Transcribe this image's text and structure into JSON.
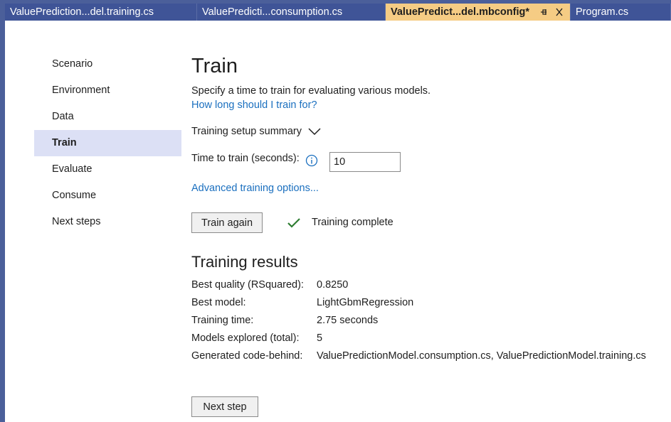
{
  "tabs": [
    {
      "label": "ValuePrediction...del.training.cs",
      "active": false
    },
    {
      "label": "ValuePredicti...consumption.cs",
      "active": false
    },
    {
      "label": "ValuePredict...del.mbconfig*",
      "active": true
    },
    {
      "label": "Program.cs",
      "active": false
    }
  ],
  "nav": {
    "items": [
      "Scenario",
      "Environment",
      "Data",
      "Train",
      "Evaluate",
      "Consume",
      "Next steps"
    ],
    "selected": "Train"
  },
  "main": {
    "title": "Train",
    "subtitle": "Specify a time to train for evaluating various models.",
    "help_link": "How long should I train for?",
    "summary_label": "Training setup summary",
    "time_label": "Time to train (seconds):",
    "time_value": "10",
    "advanced_link": "Advanced training options...",
    "train_button": "Train again",
    "status_text": "Training complete",
    "results_title": "Training results",
    "results": [
      {
        "key": "Best quality (RSquared):",
        "value": "0.8250"
      },
      {
        "key": "Best model:",
        "value": "LightGbmRegression"
      },
      {
        "key": "Training time:",
        "value": "2.75 seconds"
      },
      {
        "key": "Models explored (total):",
        "value": "5"
      },
      {
        "key": "Generated code-behind:",
        "value": "ValuePredictionModel.consumption.cs, ValuePredictionModel.training.cs"
      }
    ],
    "next_button": "Next step"
  },
  "colors": {
    "tab_bar": "#3f5497",
    "active_tab": "#f5cc84",
    "nav_selected": "#dce0f5",
    "link": "#1a6fbf",
    "check": "#2e7d32"
  },
  "icons": {
    "pin": "pin-icon",
    "close": "close-icon",
    "chevron": "chevron-down-icon",
    "info": "info-icon",
    "check": "checkmark-icon"
  }
}
